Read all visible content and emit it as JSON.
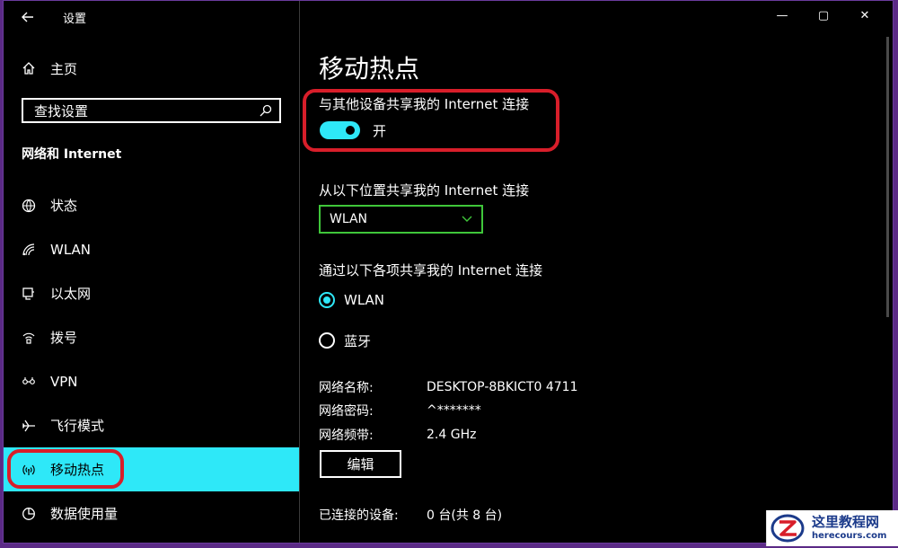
{
  "window": {
    "title": "设置",
    "controls": {
      "minimize": "—",
      "maximize": "▢",
      "close": "✕"
    }
  },
  "sidebar": {
    "home_label": "主页",
    "search": {
      "value": "查找设置"
    },
    "section_heading": "网络和 Internet",
    "items": [
      {
        "label": "状态",
        "icon": "globe-icon"
      },
      {
        "label": "WLAN",
        "icon": "wifi-icon"
      },
      {
        "label": "以太网",
        "icon": "ethernet-icon"
      },
      {
        "label": "拨号",
        "icon": "dialup-icon"
      },
      {
        "label": "VPN",
        "icon": "vpn-icon"
      },
      {
        "label": "飞行模式",
        "icon": "airplane-icon"
      },
      {
        "label": "移动热点",
        "icon": "hotspot-icon",
        "active": true
      },
      {
        "label": "数据使用量",
        "icon": "data-usage-icon"
      }
    ]
  },
  "main": {
    "title": "移动热点",
    "share_label": "与其他设备共享我的 Internet 连接",
    "toggle_state": "开",
    "from_label": "从以下位置共享我的 Internet 连接",
    "from_selected": "WLAN",
    "via_label": "通过以下各项共享我的 Internet 连接",
    "via_options": [
      {
        "label": "WLAN",
        "checked": true
      },
      {
        "label": "蓝牙",
        "checked": false
      }
    ],
    "network_name_label": "网络名称:",
    "network_name": "DESKTOP-8BKICT0 4711",
    "network_password_label": "网络密码:",
    "network_password": "^*******",
    "network_band_label": "网络频带:",
    "network_band": "2.4 GHz",
    "edit_button": "编辑",
    "connected_label": "已连接的设备:",
    "connected_value": "0 台(共 8 台)"
  },
  "colors": {
    "accent": "#2ee8f8",
    "highlight_ring": "#d81e2a",
    "dropdown_border": "#3fc63a",
    "frame": "#5b2a86"
  },
  "watermark": {
    "name": "这里教程网",
    "url": "herecours.com"
  }
}
